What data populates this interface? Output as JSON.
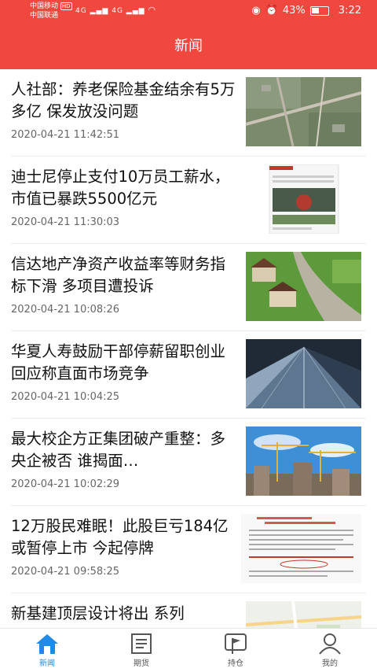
{
  "status_bar": {
    "carrier1": "中国移动",
    "carrier2": "中国联通",
    "hd": "HD",
    "net1": "4G",
    "net2": "4G",
    "battery_pct": "43%",
    "time": "3:22"
  },
  "header": {
    "title": "新闻"
  },
  "news": [
    {
      "title": "人社部：养老保险基金结余有5万多亿 保发放没问题",
      "time": "2020-04-21 11:42:51",
      "thumb": "aerial-map"
    },
    {
      "title": "迪士尼停止支付10万员工薪水，市值已暴跌5500亿元",
      "time": "2020-04-21 11:30:03",
      "thumb": "webpage-screenshot"
    },
    {
      "title": "信达地产净资产收益率等财务指标下滑 多项目遭投诉",
      "time": "2020-04-21 10:08:26",
      "thumb": "village-houses"
    },
    {
      "title": "华夏人寿鼓励干部停薪留职创业 回应称直面市场竞争",
      "time": "2020-04-21 10:04:25",
      "thumb": "glass-skyscraper"
    },
    {
      "title": "最大校企方正集团破产重整：多央企被否 谁揭面…",
      "time": "2020-04-21 10:02:29",
      "thumb": "construction-cranes"
    },
    {
      "title": "12万股民难眠！此股巨亏184亿或暂停上市 今起停牌",
      "time": "2020-04-21 09:58:25",
      "thumb": "document-scan"
    },
    {
      "title": "新基建顶层设计将出 系列",
      "time": "",
      "thumb": "street-map"
    }
  ],
  "tabs": [
    {
      "label": "新闻",
      "icon": "home-icon",
      "active": true
    },
    {
      "label": "期货",
      "icon": "book-icon",
      "active": false
    },
    {
      "label": "持仓",
      "icon": "flag-icon",
      "active": false
    },
    {
      "label": "我的",
      "icon": "user-icon",
      "active": false
    }
  ],
  "colors": {
    "header": "#f0473f",
    "active_tab": "#1f8ae8"
  }
}
